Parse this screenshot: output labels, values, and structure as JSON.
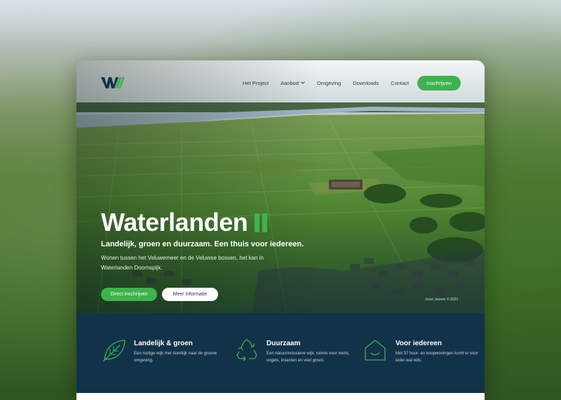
{
  "colors": {
    "accent": "#3fb24e",
    "navy": "#12324a",
    "nav_text": "#1f3a4e"
  },
  "logo": {
    "icon": "waterlanden-w-logo"
  },
  "nav": {
    "items": [
      {
        "label": "Het Project"
      },
      {
        "label": "Aanbod",
        "has_dropdown": true
      },
      {
        "label": "Omgeving"
      },
      {
        "label": "Downloads"
      },
      {
        "label": "Contact"
      }
    ],
    "cta_label": "Inschrijven"
  },
  "hero": {
    "title": "Waterlanden",
    "subtitle": "Landelijk, groen en duurzaam. Een thuis voor iedereen.",
    "description": "Wonen tussen het Veluwemeer en de Veluwse bossen, het kan in Waterlanden Doornspijk.",
    "primary_button": "Direct inschrijven",
    "secondary_button": "Meer informatie",
    "photo_credit": "Joost Jansen © 2023"
  },
  "features": [
    {
      "icon": "leaf-icon",
      "title": "Landelijk & groen",
      "description": "Een rustige wijk met doorkijk naar de groene omgeving."
    },
    {
      "icon": "recycle-icon",
      "title": "Duurzaam",
      "description": "Een natuurinclusieve wijk; ruimte voor mens, vogels, insecten en veel groen."
    },
    {
      "icon": "house-icon",
      "title": "Voor iedereen",
      "description": "Met 37 huur- en koopwoningen komt er voor ieder wat wils."
    }
  ]
}
